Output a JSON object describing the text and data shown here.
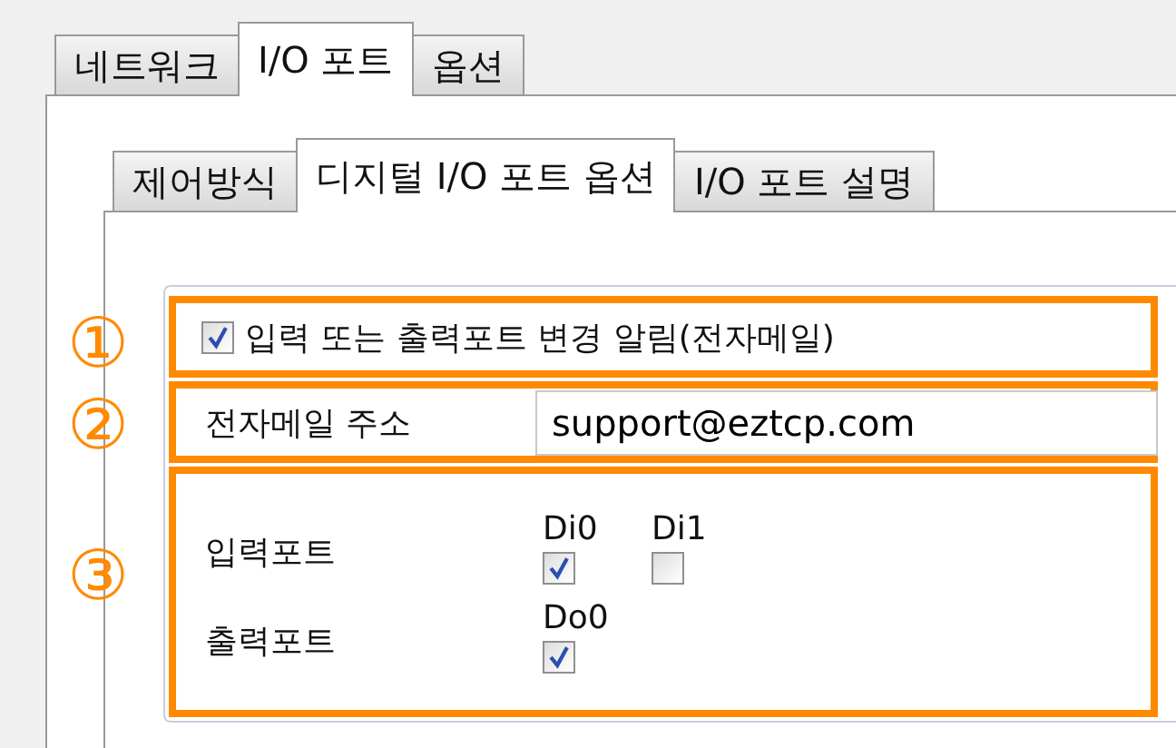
{
  "outer_tabs": [
    {
      "label": "네트워크",
      "selected": false
    },
    {
      "label": "I/O 포트",
      "selected": true
    },
    {
      "label": "옵션",
      "selected": false
    }
  ],
  "inner_tabs": [
    {
      "label": "제어방식",
      "selected": false
    },
    {
      "label": "디지털 I/O 포트 옵션",
      "selected": true
    },
    {
      "label": "I/O 포트 설명",
      "selected": false
    }
  ],
  "notify": {
    "label": "입력 또는 출력포트 변경 알림(전자메일)",
    "checked": true
  },
  "email": {
    "label": "전자메일 주소",
    "value": "support@eztcp.com"
  },
  "ports": [
    {
      "label": "입력포트",
      "items": [
        {
          "name": "Di0",
          "checked": true
        },
        {
          "name": "Di1",
          "checked": false
        }
      ]
    },
    {
      "label": "출력포트",
      "items": [
        {
          "name": "Do0",
          "checked": true
        }
      ]
    }
  ],
  "callouts": [
    "①",
    "②",
    "③"
  ]
}
